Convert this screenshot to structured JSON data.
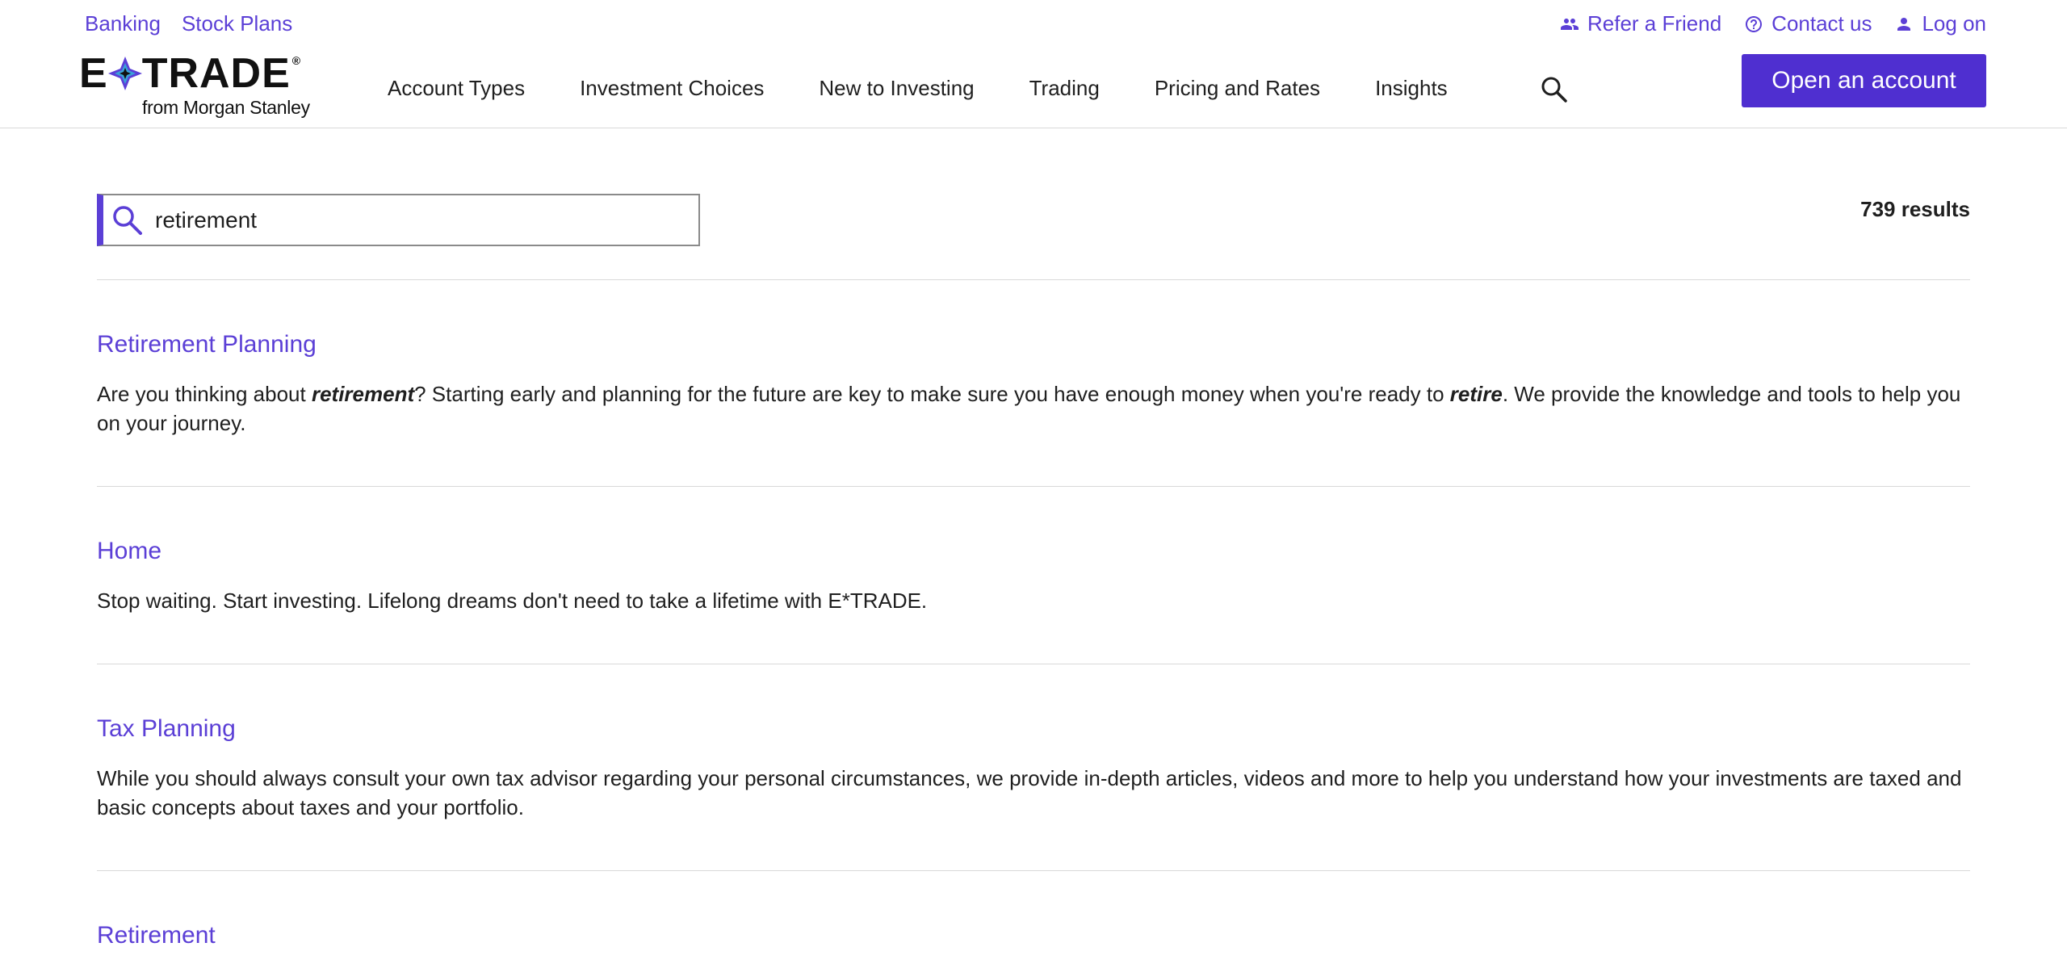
{
  "utility_left": [
    "Banking",
    "Stock Plans"
  ],
  "utility_right": [
    {
      "label": "Refer a Friend",
      "icon": "people-icon"
    },
    {
      "label": "Contact us",
      "icon": "help-circle-icon"
    },
    {
      "label": "Log on",
      "icon": "person-icon"
    }
  ],
  "logo": {
    "word": "ETRADE",
    "sub": "from Morgan Stanley"
  },
  "nav": [
    "Account Types",
    "Investment Choices",
    "New to Investing",
    "Trading",
    "Pricing and Rates",
    "Insights"
  ],
  "open_account_label": "Open an account",
  "search": {
    "value": "retirement",
    "icon": "search-icon"
  },
  "result_count": "739 results",
  "results": [
    {
      "title": "Retirement Planning",
      "desc_parts": [
        "Are you thinking about ",
        "retirement",
        "? Starting early and planning for the future are key to make sure you have enough money when you're ready to ",
        "retire",
        ". We provide the knowledge and tools to help you on your journey."
      ]
    },
    {
      "title": "Home",
      "desc": "Stop waiting. Start investing. Lifelong dreams don't need to take a lifetime with E*TRADE."
    },
    {
      "title": "Tax Planning",
      "desc": "While you should always consult your own tax advisor regarding your personal circumstances, we provide in-depth articles, videos and more to help you understand how your investments are taxed and basic concepts about taxes and your portfolio."
    },
    {
      "title": "Retirement"
    }
  ],
  "colors": {
    "accent": "#5b3fd6",
    "button": "#4f2fd0"
  }
}
